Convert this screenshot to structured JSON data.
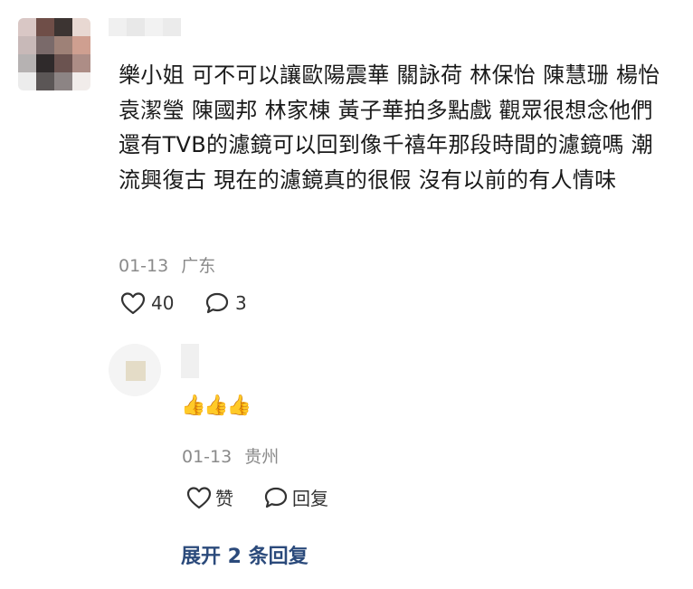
{
  "comment": {
    "text": "樂小姐 可不可以讓歐陽震華 關詠荷 林保怡 陳慧珊 楊怡 袁潔瑩 陳國邦 林家棟 黃子華拍多點戲 觀眾很想念他們 還有TVB的濾鏡可以回到像千禧年那段時間的濾鏡嗎 潮流興復古 現在的濾鏡真的很假 沒有以前的有人情味",
    "date": "01-13",
    "location": "广东",
    "likes": "40",
    "replies_count": "3",
    "like_icon": "heart-icon",
    "reply_icon": "comment-bubble-icon"
  },
  "reply": {
    "text": "👍👍👍",
    "date": "01-13",
    "location": "贵州",
    "like_label": "赞",
    "reply_label": "回复"
  },
  "expand_label": "展开 2 条回复",
  "colors": {
    "link": "#2b4a7b",
    "meta": "#8a8a8a",
    "text": "#1a1a1a"
  }
}
